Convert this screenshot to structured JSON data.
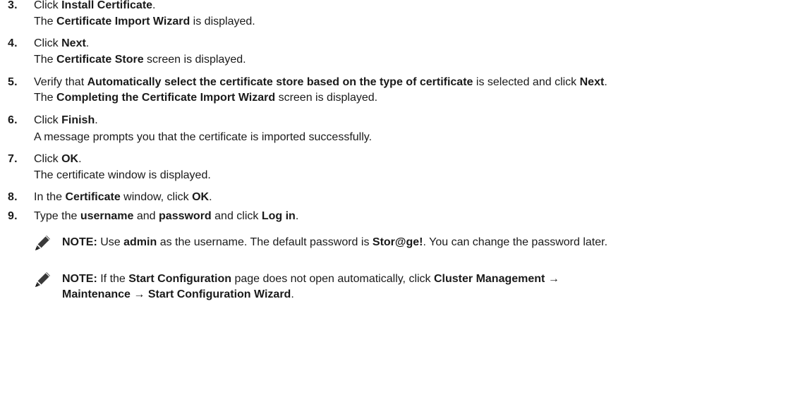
{
  "steps": [
    {
      "num": "3.",
      "parts": [
        "Click ",
        "Install Certificate",
        "."
      ],
      "sub": [
        "The ",
        "Certificate Import Wizard",
        " is displayed."
      ]
    },
    {
      "num": "4.",
      "parts": [
        "Click ",
        "Next",
        "."
      ],
      "sub": [
        "The ",
        "Certificate Store",
        " screen is displayed."
      ]
    },
    {
      "num": "5.",
      "parts": [
        "Verify that ",
        "Automatically select the certificate store based on the type of certificate",
        " is selected and click ",
        "Next",
        "."
      ],
      "sub": [
        "The ",
        "Completing the Certificate Import Wizard",
        " screen is displayed."
      ]
    },
    {
      "num": "6.",
      "parts": [
        "Click ",
        "Finish",
        "."
      ],
      "sub": [
        "A message prompts you that the certificate is imported successfully."
      ]
    },
    {
      "num": "7.",
      "parts": [
        "Click ",
        "OK",
        "."
      ],
      "sub": [
        "The certificate window is displayed."
      ]
    },
    {
      "num": "8.",
      "parts": [
        "In the ",
        "Certificate",
        " window, click ",
        "OK",
        "."
      ]
    },
    {
      "num": "9.",
      "parts": [
        "Type the ",
        "username",
        " and ",
        "password",
        " and click ",
        "Log in",
        "."
      ]
    }
  ],
  "notes": [
    {
      "icon": "pencil-note-icon",
      "lines": [
        [
          "NOTE:",
          " Use ",
          "admin",
          " as the username. The default password is ",
          "Stor@ge!",
          ". You can change the password later."
        ]
      ]
    },
    {
      "icon": "pencil-note-icon",
      "lines": [
        [
          "NOTE:",
          " If the ",
          "Start Configuration",
          " page does not open automatically, click ",
          "Cluster Management",
          " →"
        ],
        [
          "Maintenance",
          " → ",
          "Start Configuration Wizard",
          "."
        ]
      ]
    }
  ]
}
